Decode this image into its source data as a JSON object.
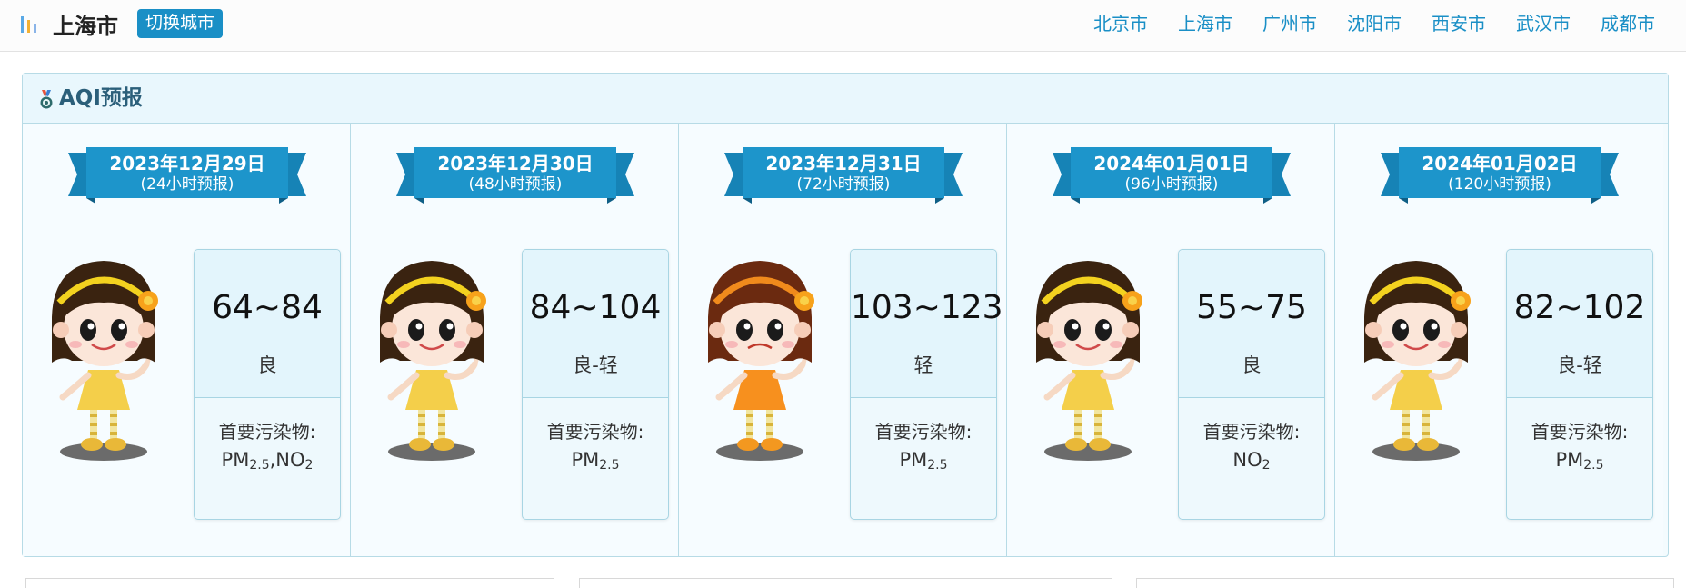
{
  "header": {
    "logo_icon": "bar-chart-icon",
    "city": "上海市",
    "switch_label": "切换城市",
    "accent": "#1a8fc6",
    "cities": [
      "北京市",
      "上海市",
      "广州市",
      "沈阳市",
      "西安市",
      "武汉市",
      "成都市"
    ]
  },
  "panel": {
    "icon": "medal-icon",
    "title": "AQI预报"
  },
  "forecasts": [
    {
      "date": "2023年12月29日",
      "sub": "(24小时预报)",
      "range": "64~84",
      "level": "良",
      "pollutant_label": "首要污染物:",
      "pollutants": [
        {
          "base": "PM",
          "sub": "2.5"
        },
        {
          "base": ",NO",
          "sub": "2"
        }
      ],
      "mood": "happy"
    },
    {
      "date": "2023年12月30日",
      "sub": "(48小时预报)",
      "range": "84~104",
      "level": "良-轻",
      "pollutant_label": "首要污染物:",
      "pollutants": [
        {
          "base": "PM",
          "sub": "2.5"
        }
      ],
      "mood": "happy"
    },
    {
      "date": "2023年12月31日",
      "sub": "(72小时预报)",
      "range": "103~123",
      "level": "轻",
      "pollutant_label": "首要污染物:",
      "pollutants": [
        {
          "base": "PM",
          "sub": "2.5"
        }
      ],
      "mood": "sad"
    },
    {
      "date": "2024年01月01日",
      "sub": "(96小时预报)",
      "range": "55~75",
      "level": "良",
      "pollutant_label": "首要污染物:",
      "pollutants": [
        {
          "base": "NO",
          "sub": "2"
        }
      ],
      "mood": "happy"
    },
    {
      "date": "2024年01月02日",
      "sub": "(120小时预报)",
      "range": "82~102",
      "level": "良-轻",
      "pollutant_label": "首要污染物:",
      "pollutants": [
        {
          "base": "PM",
          "sub": "2.5"
        }
      ],
      "mood": "happy"
    }
  ]
}
